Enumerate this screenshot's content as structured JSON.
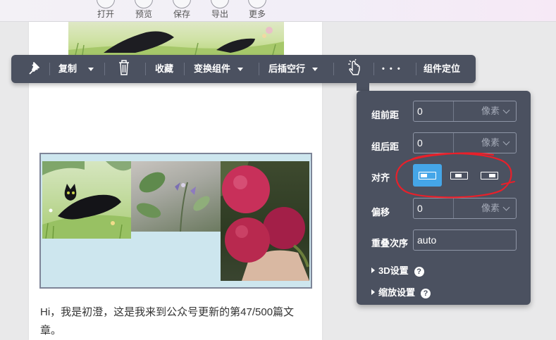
{
  "top_toolbar": {
    "items": [
      {
        "label": "打开",
        "icon": "folder-open-icon"
      },
      {
        "label": "预览",
        "icon": "preview-icon"
      },
      {
        "label": "保存",
        "icon": "save-icon"
      },
      {
        "label": "导出",
        "icon": "export-icon"
      },
      {
        "label": "更多",
        "icon": "more-icon"
      }
    ]
  },
  "component_toolbar": {
    "copy_label": "复制",
    "favorite_label": "收藏",
    "switch_label": "变换组件",
    "insert_label": "后插空行",
    "more_label": "• • •",
    "locate_label": "组件定位"
  },
  "article": {
    "body_text": "Hi，我是初澄，这是我来到公众号更新的第47/500篇文章。"
  },
  "panel": {
    "margin_top": {
      "label": "组前距",
      "value": "0",
      "unit": "像素"
    },
    "margin_bottom": {
      "label": "组后距",
      "value": "0",
      "unit": "像素"
    },
    "align": {
      "label": "对齐",
      "options": [
        "left",
        "center",
        "right"
      ],
      "selected": "left"
    },
    "offset": {
      "label": "偏移",
      "value": "0",
      "unit": "像素"
    },
    "z_index": {
      "label": "重叠次序",
      "value": "auto"
    },
    "section_3d": "3D设置",
    "section_scale": "缩放设置",
    "help_symbol": "?"
  },
  "colors": {
    "toolbar_bg": "#4b5160",
    "align_selected": "#45a6e8",
    "annotation_red": "#e8202a",
    "collage_bg": "#cde6ee"
  }
}
